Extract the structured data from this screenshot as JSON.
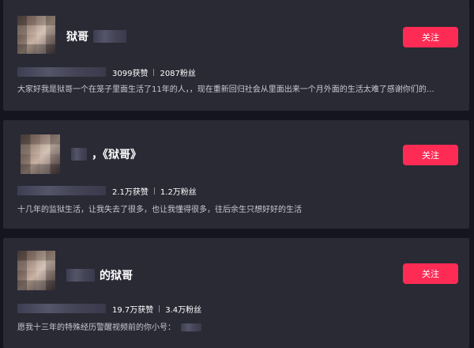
{
  "users": [
    {
      "name": "狱哥",
      "likes": "3099获赞",
      "fans": "2087粉丝",
      "bio": "大家好我是狱哥一个在笼子里面生活了11年的人，，现在重新回归社会从里面出来一个月外面的生活太难了感谢你们的…",
      "follow_label": "关注"
    },
    {
      "name": "，《狱哥》",
      "likes": "2.1万获赞",
      "fans": "1.2万粉丝",
      "bio": "十几年的监狱生活，让我失去了很多，也让我懂得很多，往后余生只想好好的生活",
      "follow_label": "关注"
    },
    {
      "name": "的狱哥",
      "likes": "19.7万获赞",
      "fans": "3.4万粉丝",
      "bio": "愿我十三年的特殊经历警醒视频前的你小号：",
      "follow_label": "关注"
    }
  ],
  "colors": {
    "background": "#15151f",
    "card": "#2a2a35",
    "accent": "#fe2c55"
  }
}
